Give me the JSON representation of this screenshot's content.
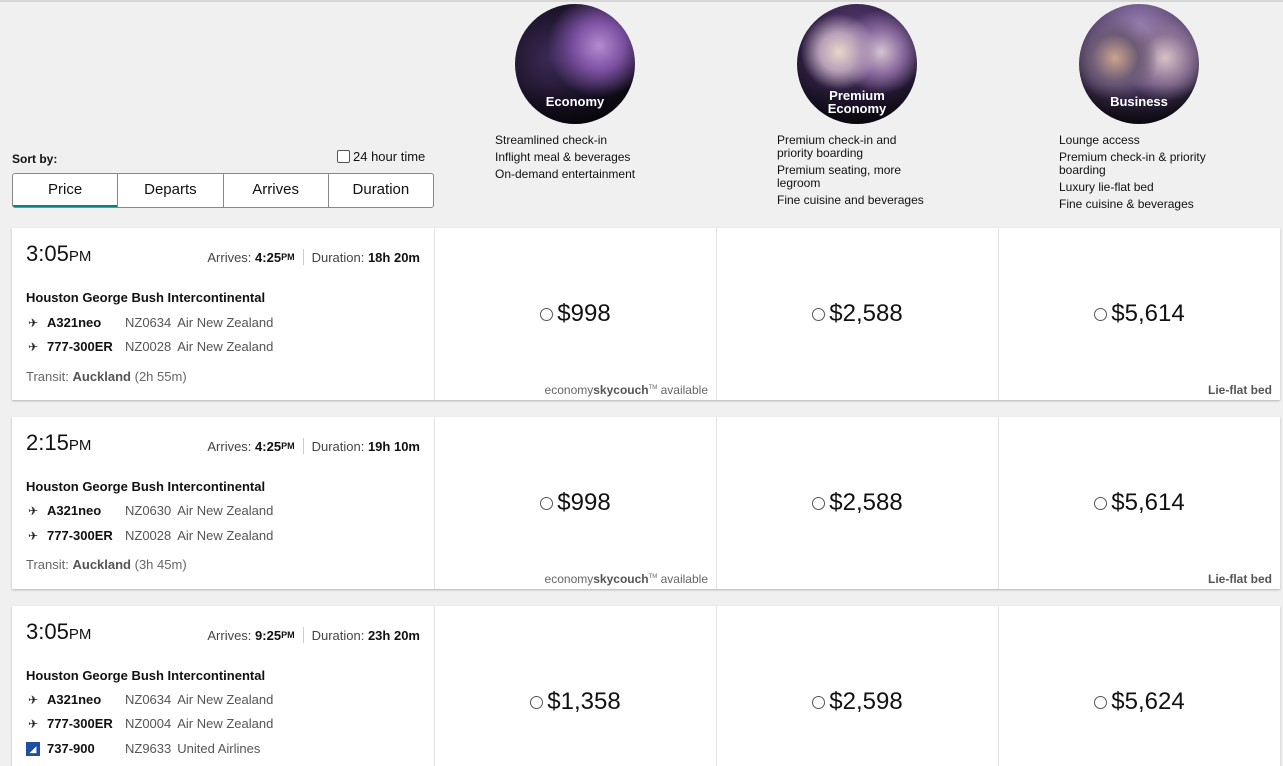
{
  "cabins": [
    {
      "name_line1": "Economy",
      "name_line2": "",
      "features": [
        "Streamlined check-in",
        "Inflight meal & beverages",
        "On-demand entertainment"
      ]
    },
    {
      "name_line1": "Premium",
      "name_line2": "Economy",
      "features": [
        "Premium check-in and priority boarding",
        "Premium seating, more legroom",
        "Fine cuisine and beverages"
      ]
    },
    {
      "name_line1": "Business",
      "name_line2": "",
      "features": [
        "Lounge access",
        "Premium check-in & priority boarding",
        "Luxury lie-flat bed",
        "Fine cuisine & beverages"
      ]
    }
  ],
  "sort": {
    "label": "Sort by:",
    "hour_toggle_label": "24 hour time",
    "tabs": [
      "Price",
      "Departs",
      "Arrives",
      "Duration"
    ],
    "active": "Price"
  },
  "labels": {
    "arrives": "Arrives:",
    "duration": "Duration:",
    "transit": "Transit:",
    "sky_pre": "economy",
    "sky_brand": "skycouch",
    "sky_tm": "TM",
    "sky_post": "available",
    "lieflat": "Lie-flat bed"
  },
  "flights": [
    {
      "depart_time": "3:05",
      "depart_ampm": "PM",
      "arrive_time": "4:25",
      "arrive_ampm": "PM",
      "duration": "18h 20m",
      "origin": "Houston George Bush Intercontinental",
      "segments": [
        {
          "aircraft": "A321neo",
          "flight": "NZ0634",
          "airline": "Air New Zealand",
          "icon": "air-new-zealand-icon"
        },
        {
          "aircraft": "777-300ER",
          "flight": "NZ0028",
          "airline": "Air New Zealand",
          "icon": "air-new-zealand-icon"
        }
      ],
      "transit_city": "Auckland",
      "transit_time": "(2h 55m)",
      "prices": {
        "economy": "$998",
        "premium": "$2,588",
        "business": "$5,614"
      }
    },
    {
      "depart_time": "2:15",
      "depart_ampm": "PM",
      "arrive_time": "4:25",
      "arrive_ampm": "PM",
      "duration": "19h 10m",
      "origin": "Houston George Bush Intercontinental",
      "segments": [
        {
          "aircraft": "A321neo",
          "flight": "NZ0630",
          "airline": "Air New Zealand",
          "icon": "air-new-zealand-icon"
        },
        {
          "aircraft": "777-300ER",
          "flight": "NZ0028",
          "airline": "Air New Zealand",
          "icon": "air-new-zealand-icon"
        }
      ],
      "transit_city": "Auckland",
      "transit_time": "(3h 45m)",
      "prices": {
        "economy": "$998",
        "premium": "$2,588",
        "business": "$5,614"
      }
    },
    {
      "depart_time": "3:05",
      "depart_ampm": "PM",
      "arrive_time": "9:25",
      "arrive_ampm": "PM",
      "duration": "23h 20m",
      "origin": "Houston George Bush Intercontinental",
      "segments": [
        {
          "aircraft": "A321neo",
          "flight": "NZ0634",
          "airline": "Air New Zealand",
          "icon": "air-new-zealand-icon"
        },
        {
          "aircraft": "777-300ER",
          "flight": "NZ0004",
          "airline": "Air New Zealand",
          "icon": "air-new-zealand-icon"
        },
        {
          "aircraft": "737-900",
          "flight": "NZ9633",
          "airline": "United Airlines",
          "icon": "united-airlines-icon"
        }
      ],
      "prices": {
        "economy": "$1,358",
        "premium": "$2,598",
        "business": "$5,624"
      }
    }
  ]
}
